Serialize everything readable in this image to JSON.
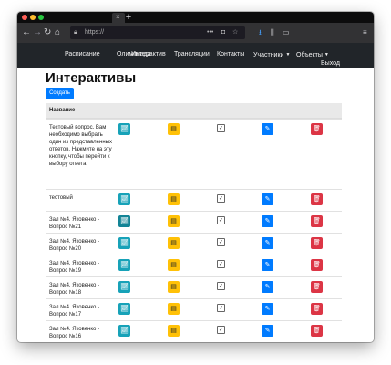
{
  "browser": {
    "url": "https://",
    "new_tab_symbol": "+",
    "tab_close_symbol": "×",
    "toolbar_icons": [
      "back-icon",
      "forward-icon",
      "reload-icon",
      "home-icon",
      "lock-icon",
      "more-icon",
      "pocket-icon",
      "star-icon",
      "download-icon",
      "library-icon",
      "sidebar-icon",
      "menu-icon"
    ]
  },
  "nav": {
    "items": [
      {
        "label": "Расписание"
      },
      {
        "label": "Олимпиада"
      },
      {
        "label": "Интерактив"
      },
      {
        "label": "Трансляции"
      },
      {
        "label": "Контакты"
      },
      {
        "label": "Участники"
      },
      {
        "label": "Объекты"
      }
    ],
    "logout_label": "Выход"
  },
  "main": {
    "title": "Интерактивы",
    "create_label": "Создать",
    "table": {
      "header": "Название",
      "rows": [
        {
          "name": "Тестовый вопрос. Вам необходимо выбрать один из представленных ответов. Нажмите на эту кнопку, чтобы перейти к выбору ответа."
        },
        {
          "name": "тестовый"
        },
        {
          "name": "Зал №4. Яковенко - Вопрос №21"
        },
        {
          "name": "Зал №4. Яковенко - Вопрос №20"
        },
        {
          "name": "Зал №4. Яковенко - Вопрос №19"
        },
        {
          "name": "Зал №4. Яковенко - Вопрос №18"
        },
        {
          "name": "Зал №4. Яковенко - Вопрос №17"
        },
        {
          "name": "Зал №4. Яковенко - Вопрос №16"
        },
        {
          "name": ""
        }
      ]
    }
  },
  "colors": {
    "primary": "#007bff",
    "info": "#17a2b8",
    "warning": "#ffc107",
    "danger": "#dc3545",
    "navbar": "#212529"
  }
}
